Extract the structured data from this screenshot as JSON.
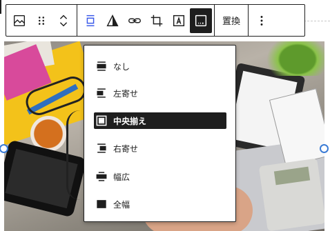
{
  "toolbar": {
    "replace_label": "置換",
    "accent_color": "#3858e9",
    "buttons": [
      {
        "icon": "image-icon"
      },
      {
        "icon": "drag-handle-icon"
      },
      {
        "icon": "move-up-down-icon"
      },
      {
        "icon": "align-center-icon"
      },
      {
        "icon": "duotone-icon"
      },
      {
        "icon": "link-icon"
      },
      {
        "icon": "crop-icon"
      },
      {
        "icon": "text-overlay-icon"
      },
      {
        "icon": "caption-icon"
      },
      {
        "icon": "more-options-icon"
      }
    ]
  },
  "align_menu": {
    "items": [
      {
        "label": "なし",
        "icon": "align-none-icon"
      },
      {
        "label": "左寄せ",
        "icon": "align-left-icon"
      },
      {
        "label": "中央揃え",
        "icon": "align-center-icon",
        "selected": true
      },
      {
        "label": "右寄せ",
        "icon": "align-right-icon"
      },
      {
        "label": "幅広",
        "icon": "align-wide-icon"
      },
      {
        "label": "全幅",
        "icon": "align-full-icon"
      }
    ]
  }
}
